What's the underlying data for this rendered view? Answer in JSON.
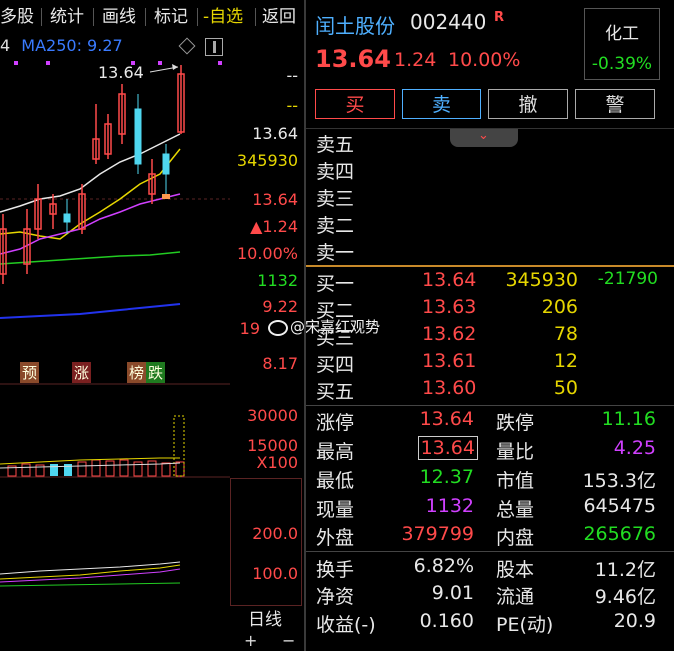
{
  "toolbar": {
    "items": [
      "多股",
      "统计",
      "画线",
      "标记",
      "-自选",
      "返回"
    ]
  },
  "chart": {
    "ma_label": "MA250: 9.27",
    "ma_prefix": "4",
    "peak_label": "13.64",
    "markers": [
      "预",
      "涨",
      "榜",
      "跌"
    ]
  },
  "axis": {
    "top_dash1": "--",
    "top_dash2": "--",
    "price": "13.64",
    "volume": "345930",
    "price2": "13.64",
    "change": "▲1.24",
    "percent": "10.00%",
    "current_vol": "1132",
    "p_922": "9.22",
    "p_19": "19",
    "p_817": "8.17",
    "vol_30000": "30000",
    "vol_15000": "15000",
    "x100": "X100",
    "ind_200": "200.0",
    "ind_100": "100.0",
    "period": "日线",
    "zoom_in": "+",
    "zoom_out": "−"
  },
  "watermark": "@宋嘉红观势",
  "stock": {
    "name": "闰土股份",
    "code": "002440",
    "badge": "R",
    "price": "13.64",
    "change": "1.24",
    "percent": "10.00%",
    "sector": "化工",
    "sector_change": "-0.39%"
  },
  "buttons": {
    "buy": "买",
    "sell": "卖",
    "cancel": "撤",
    "alert": "警"
  },
  "orderbook": {
    "sells": [
      {
        "label": "卖五"
      },
      {
        "label": "卖四"
      },
      {
        "label": "卖三"
      },
      {
        "label": "卖二"
      },
      {
        "label": "卖一"
      }
    ],
    "buys": [
      {
        "label": "买一",
        "price": "13.64",
        "vol": "345930",
        "extra": "-21790"
      },
      {
        "label": "买二",
        "price": "13.63",
        "vol": "206",
        "extra": ""
      },
      {
        "label": "买三",
        "price": "13.62",
        "vol": "78",
        "extra": ""
      },
      {
        "label": "买四",
        "price": "13.61",
        "vol": "12",
        "extra": ""
      },
      {
        "label": "买五",
        "price": "13.60",
        "vol": "50",
        "extra": ""
      }
    ]
  },
  "stats": {
    "zt_l": "涨停",
    "zt_v": "13.64",
    "dt_l": "跌停",
    "dt_v": "11.16",
    "zg_l": "最高",
    "zg_v": "13.64",
    "lb_l": "量比",
    "lb_v": "4.25",
    "zd_l": "最低",
    "zd_v": "12.37",
    "sz_l": "市值",
    "sz_v": "153.3亿",
    "xl_l": "现量",
    "xl_v": "1132",
    "zl_l": "总量",
    "zl_v": "645475",
    "wp_l": "外盘",
    "wp_v": "379799",
    "np_l": "内盘",
    "np_v": "265676",
    "hs_l": "换手",
    "hs_v": "6.82%",
    "gb_l": "股本",
    "gb_v": "11.2亿",
    "jz_l": "净资",
    "jz_v": "9.01",
    "lt_l": "流通",
    "lt_v": "9.46亿",
    "sy_l": "收益(-)",
    "sy_v": "0.160",
    "pe_l": "PE(动)",
    "pe_v": "20.9"
  }
}
